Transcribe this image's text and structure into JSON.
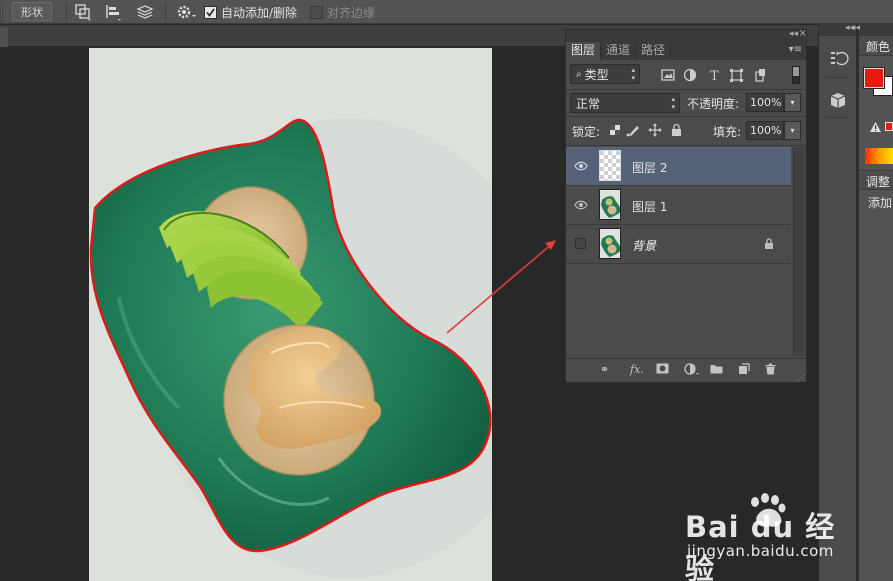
{
  "options_bar": {
    "shape_button": "形状",
    "auto_add_delete_label": "自动添加/删除",
    "auto_add_delete_checked": true,
    "align_edges_label": "对齐边缘",
    "align_edges_checked": false
  },
  "layers_panel": {
    "tabs": [
      "图层",
      "通道",
      "路径"
    ],
    "active_tab": "图层",
    "filter_kind": "类型",
    "blend_mode": "正常",
    "opacity_label": "不透明度:",
    "opacity_value": "100%",
    "lock_label": "锁定:",
    "fill_label": "填充:",
    "fill_value": "100%",
    "layers": [
      {
        "name": "图层 2",
        "visible": true,
        "selected": true,
        "thumb": "transparent"
      },
      {
        "name": "图层 1",
        "visible": true,
        "selected": false,
        "thumb": "image"
      },
      {
        "name": "背景",
        "visible": false,
        "selected": false,
        "thumb": "image",
        "locked": true
      }
    ]
  },
  "right_panels": {
    "color_tab": "颜色",
    "adjust_tab": "调整",
    "add_label": "添加",
    "foreground_color": "#e8190f",
    "background_color": "#ffffff"
  },
  "colors": {
    "accent_selection": "#566278",
    "path_outline": "#e01818",
    "annotation_arrow": "#e53c3c"
  },
  "watermark": {
    "brand": "Bai du 经验",
    "url": "jingyan.baidu.com"
  }
}
